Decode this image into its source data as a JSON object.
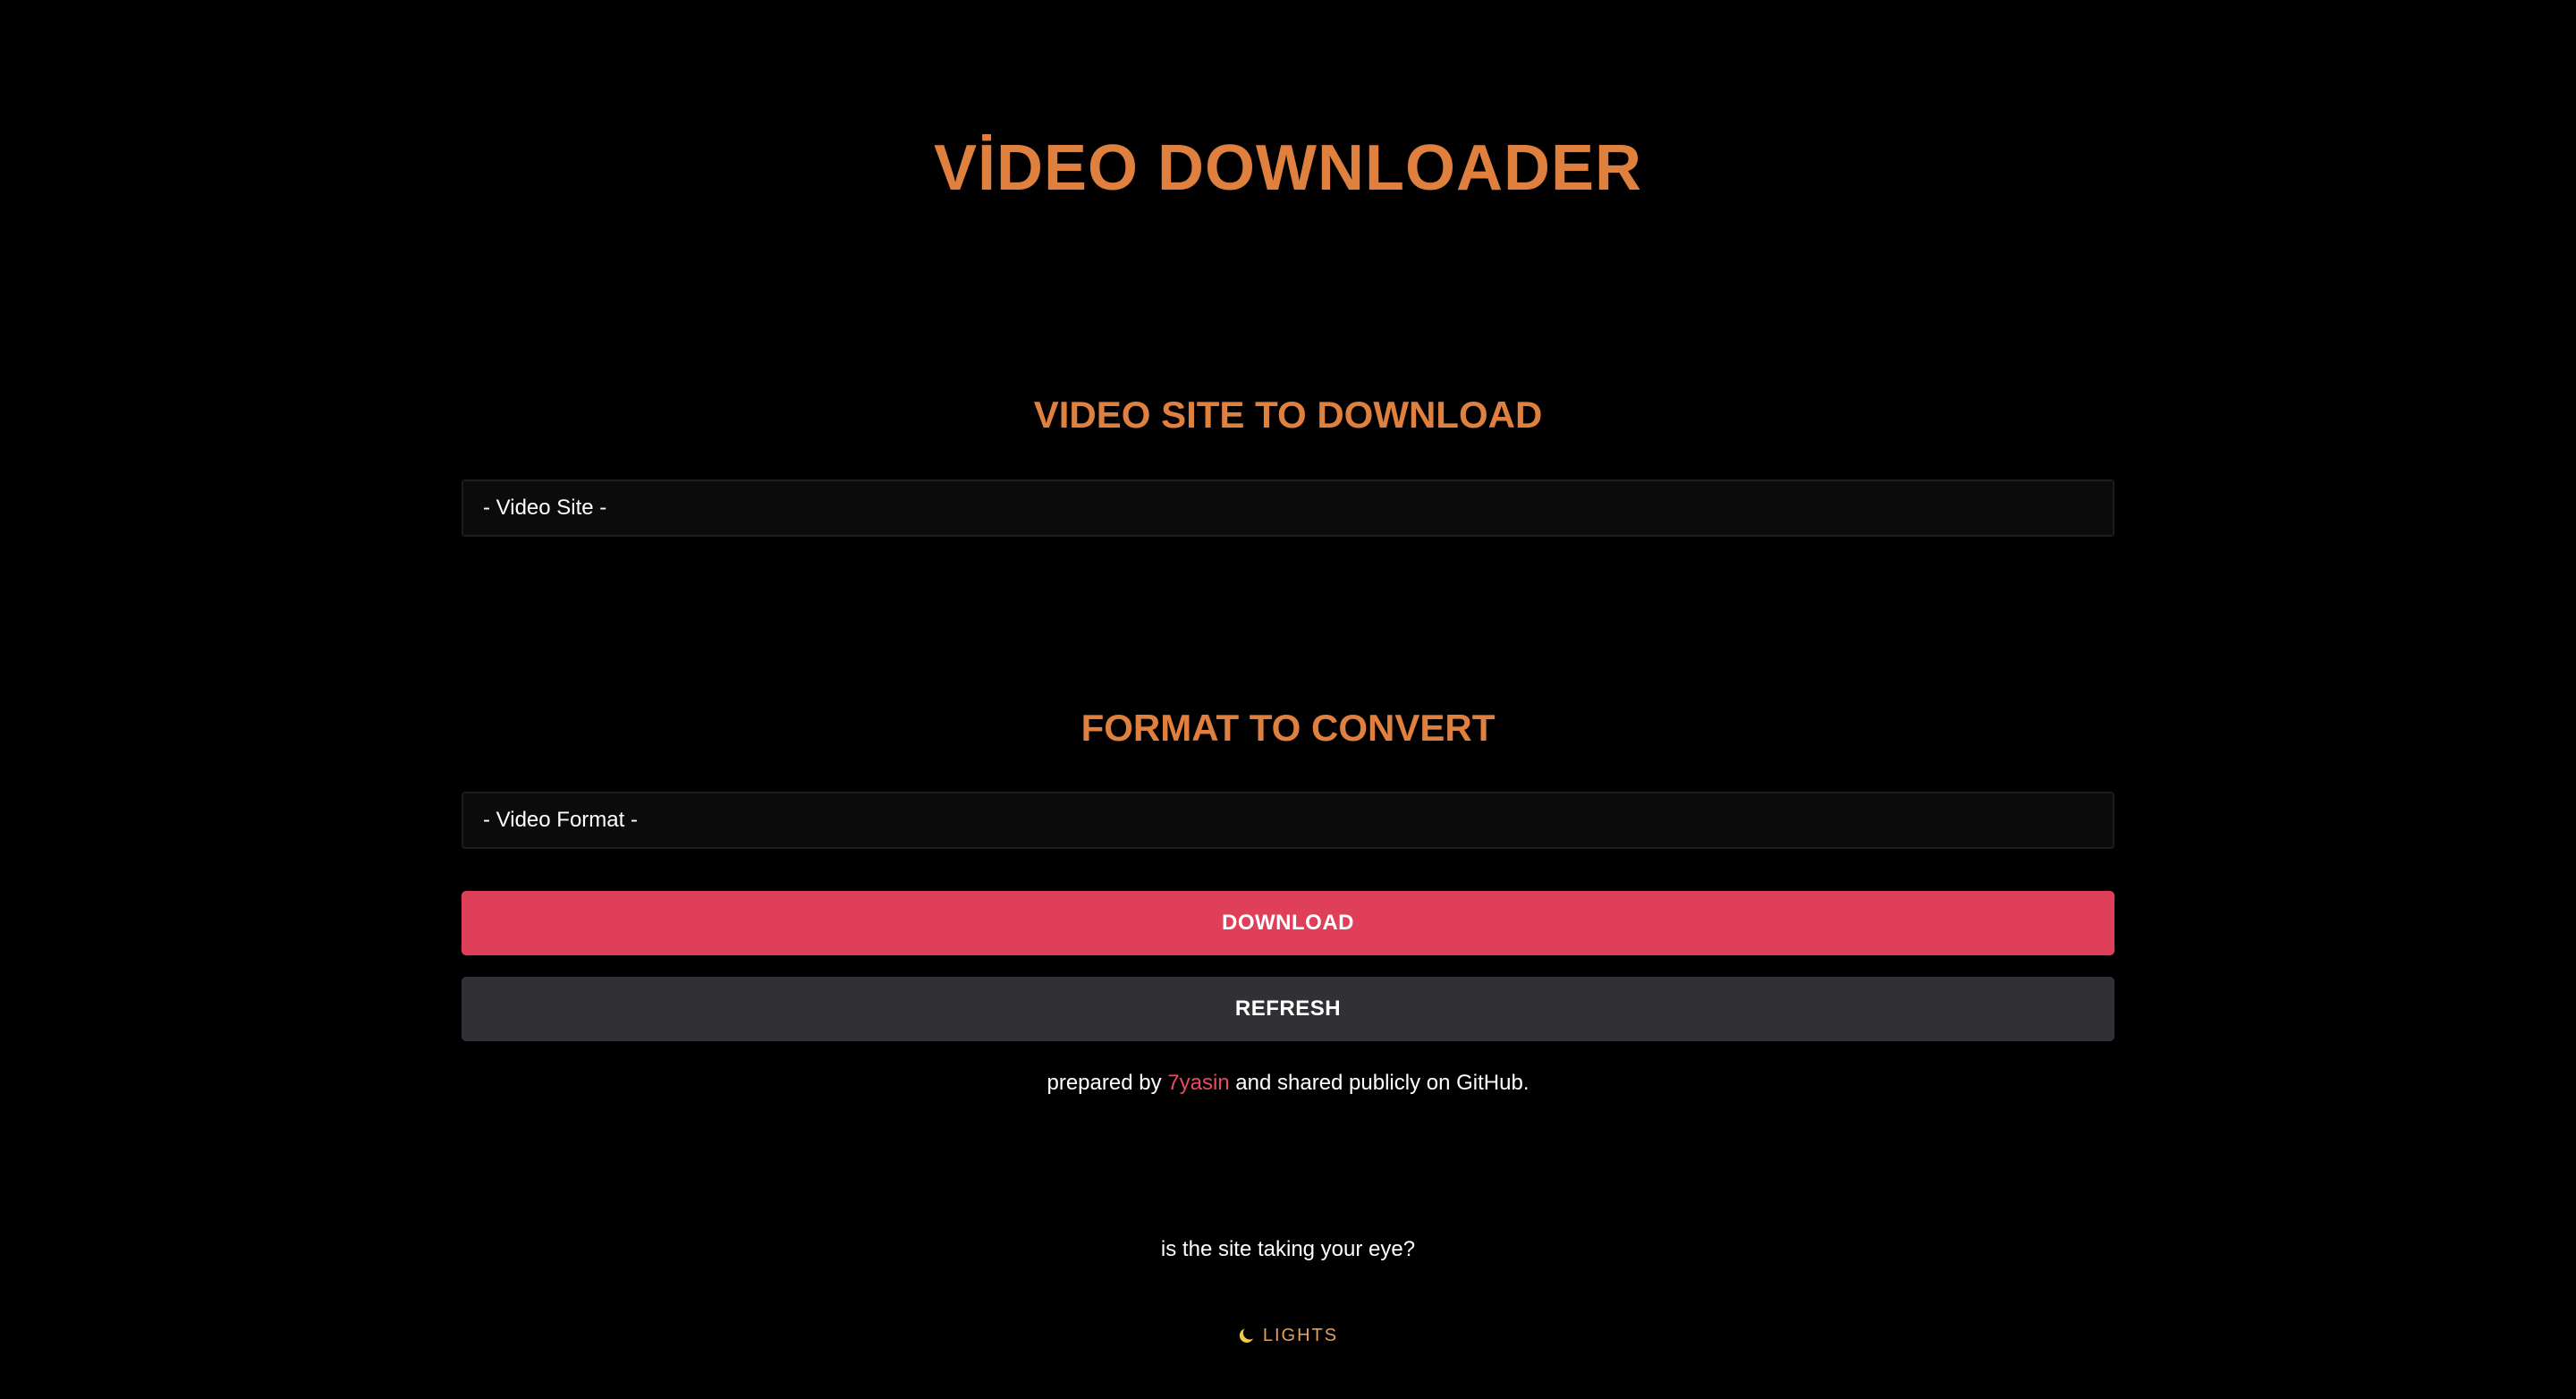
{
  "colors": {
    "accent": "#e0803f",
    "download_button": "#df3f59",
    "refresh_button": "#313035",
    "author_link": "#e84a64",
    "lights_text": "#e0a060"
  },
  "header": {
    "title": "VİDEO DOWNLOADER"
  },
  "site_section": {
    "title": "VIDEO SITE TO DOWNLOAD",
    "select_value": "- Video Site -"
  },
  "format_section": {
    "title": "FORMAT TO CONVERT",
    "select_value": "- Video Format -"
  },
  "buttons": {
    "download_label": "DOWNLOAD",
    "refresh_label": "REFRESH"
  },
  "credit": {
    "prefix": "prepared by ",
    "author": "7yasin",
    "suffix": " and shared publicly on GitHub."
  },
  "footer": {
    "question": "is the site taking your eye?",
    "lights_label": "LIGHTS",
    "lights_icon": "moon-icon"
  }
}
